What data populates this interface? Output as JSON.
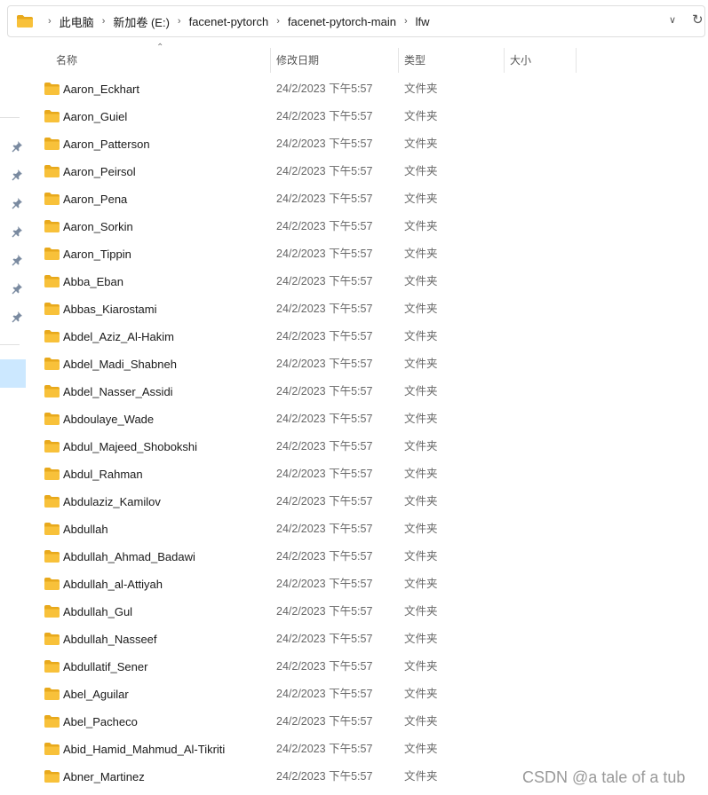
{
  "address_bar": {
    "crumbs": [
      "此电脑",
      "新加卷 (E:)",
      "facenet-pytorch",
      "facenet-pytorch-main",
      "lfw"
    ]
  },
  "columns": {
    "name": "名称",
    "modified": "修改日期",
    "type": "类型",
    "size": "大小"
  },
  "files": [
    {
      "name": "Aaron_Eckhart",
      "modified": "24/2/2023 下午5:57",
      "type": "文件夹"
    },
    {
      "name": "Aaron_Guiel",
      "modified": "24/2/2023 下午5:57",
      "type": "文件夹"
    },
    {
      "name": "Aaron_Patterson",
      "modified": "24/2/2023 下午5:57",
      "type": "文件夹"
    },
    {
      "name": "Aaron_Peirsol",
      "modified": "24/2/2023 下午5:57",
      "type": "文件夹"
    },
    {
      "name": "Aaron_Pena",
      "modified": "24/2/2023 下午5:57",
      "type": "文件夹"
    },
    {
      "name": "Aaron_Sorkin",
      "modified": "24/2/2023 下午5:57",
      "type": "文件夹"
    },
    {
      "name": "Aaron_Tippin",
      "modified": "24/2/2023 下午5:57",
      "type": "文件夹"
    },
    {
      "name": "Abba_Eban",
      "modified": "24/2/2023 下午5:57",
      "type": "文件夹"
    },
    {
      "name": "Abbas_Kiarostami",
      "modified": "24/2/2023 下午5:57",
      "type": "文件夹"
    },
    {
      "name": "Abdel_Aziz_Al-Hakim",
      "modified": "24/2/2023 下午5:57",
      "type": "文件夹"
    },
    {
      "name": "Abdel_Madi_Shabneh",
      "modified": "24/2/2023 下午5:57",
      "type": "文件夹"
    },
    {
      "name": "Abdel_Nasser_Assidi",
      "modified": "24/2/2023 下午5:57",
      "type": "文件夹"
    },
    {
      "name": "Abdoulaye_Wade",
      "modified": "24/2/2023 下午5:57",
      "type": "文件夹"
    },
    {
      "name": "Abdul_Majeed_Shobokshi",
      "modified": "24/2/2023 下午5:57",
      "type": "文件夹"
    },
    {
      "name": "Abdul_Rahman",
      "modified": "24/2/2023 下午5:57",
      "type": "文件夹"
    },
    {
      "name": "Abdulaziz_Kamilov",
      "modified": "24/2/2023 下午5:57",
      "type": "文件夹"
    },
    {
      "name": "Abdullah",
      "modified": "24/2/2023 下午5:57",
      "type": "文件夹"
    },
    {
      "name": "Abdullah_Ahmad_Badawi",
      "modified": "24/2/2023 下午5:57",
      "type": "文件夹"
    },
    {
      "name": "Abdullah_al-Attiyah",
      "modified": "24/2/2023 下午5:57",
      "type": "文件夹"
    },
    {
      "name": "Abdullah_Gul",
      "modified": "24/2/2023 下午5:57",
      "type": "文件夹"
    },
    {
      "name": "Abdullah_Nasseef",
      "modified": "24/2/2023 下午5:57",
      "type": "文件夹"
    },
    {
      "name": "Abdullatif_Sener",
      "modified": "24/2/2023 下午5:57",
      "type": "文件夹"
    },
    {
      "name": "Abel_Aguilar",
      "modified": "24/2/2023 下午5:57",
      "type": "文件夹"
    },
    {
      "name": "Abel_Pacheco",
      "modified": "24/2/2023 下午5:57",
      "type": "文件夹"
    },
    {
      "name": "Abid_Hamid_Mahmud_Al-Tikriti",
      "modified": "24/2/2023 下午5:57",
      "type": "文件夹"
    },
    {
      "name": "Abner_Martinez",
      "modified": "24/2/2023 下午5:57",
      "type": "文件夹"
    }
  ],
  "watermark": "CSDN @a tale of a tub",
  "icons": {
    "folder": "folder-icon",
    "pin": "pin-icon",
    "chevron": "chevron-right-icon",
    "dropdown": "chevron-down-icon",
    "refresh": "refresh-icon"
  },
  "colors": {
    "folder_body": "#f8c13a",
    "folder_tab": "#e8a91c",
    "selection": "#cce8ff"
  }
}
